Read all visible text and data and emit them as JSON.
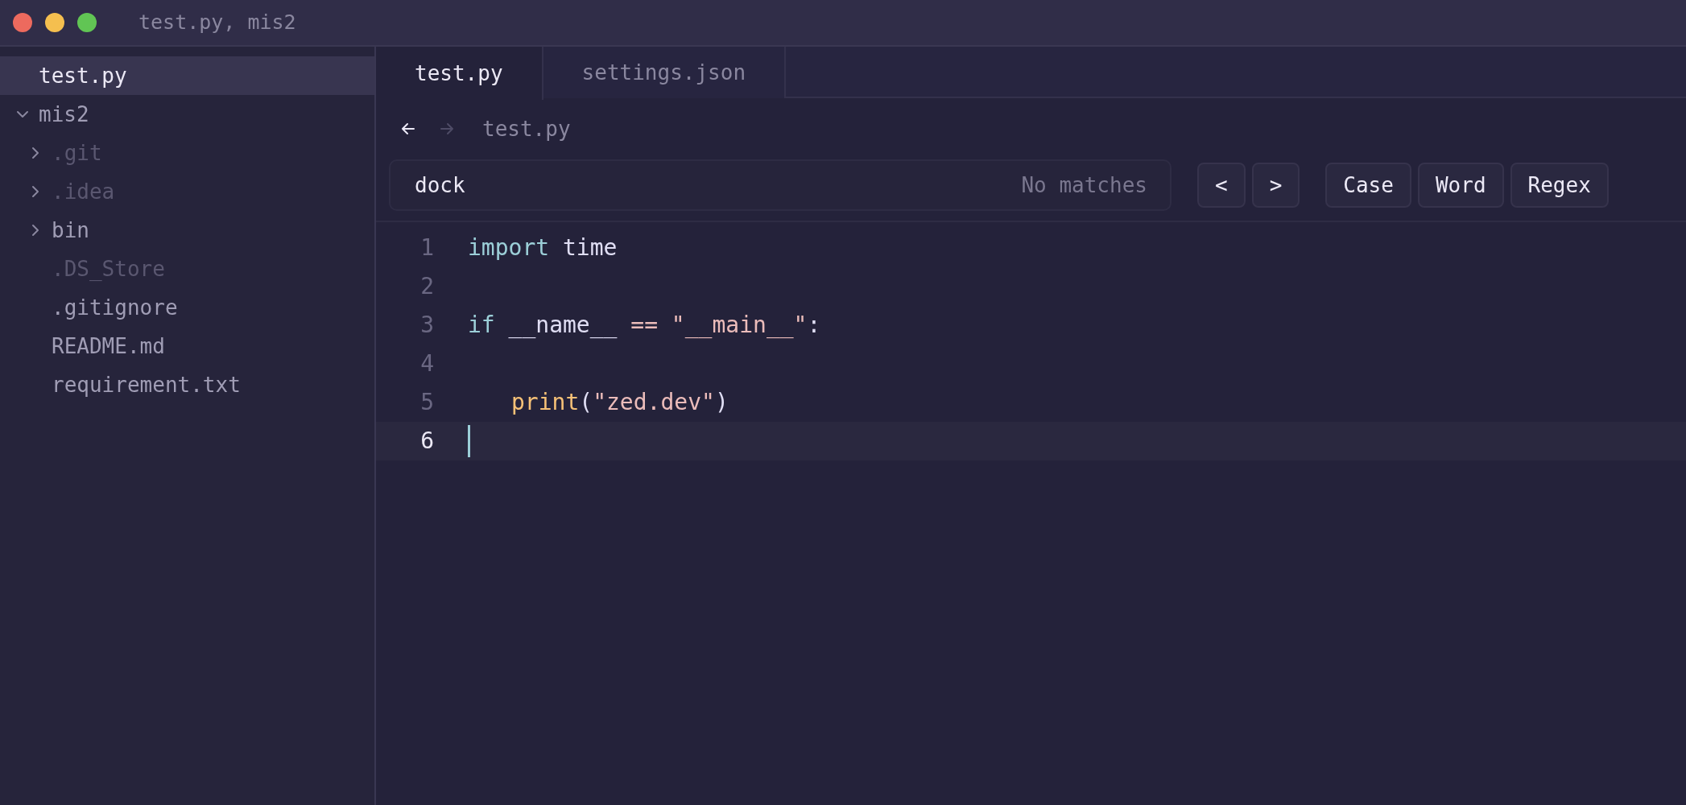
{
  "window": {
    "title": "test.py, mis2"
  },
  "tree": [
    {
      "label": "test.py",
      "kind": "file",
      "selected": true,
      "ignored": false
    },
    {
      "label": "mis2",
      "kind": "folder",
      "expanded": true,
      "selected": false,
      "ignored": false,
      "children": [
        {
          "label": ".git",
          "kind": "folder",
          "expanded": false,
          "selected": false,
          "ignored": true
        },
        {
          "label": ".idea",
          "kind": "folder",
          "expanded": false,
          "selected": false,
          "ignored": true
        },
        {
          "label": "bin",
          "kind": "folder",
          "expanded": false,
          "selected": false,
          "ignored": false
        },
        {
          "label": ".DS_Store",
          "kind": "file",
          "selected": false,
          "ignored": true
        },
        {
          "label": ".gitignore",
          "kind": "file",
          "selected": false,
          "ignored": false
        },
        {
          "label": "README.md",
          "kind": "file",
          "selected": false,
          "ignored": false
        },
        {
          "label": "requirement.txt",
          "kind": "file",
          "selected": false,
          "ignored": false
        }
      ]
    }
  ],
  "tabs": [
    {
      "label": "test.py",
      "selected": true
    },
    {
      "label": "settings.json",
      "selected": false
    }
  ],
  "breadcrumb": {
    "back_disabled": false,
    "forward_disabled": true,
    "path": "test.py"
  },
  "search": {
    "value": "dock",
    "status": "No matches",
    "nav_buttons": [
      "<",
      ">"
    ],
    "options": [
      {
        "label": "Case",
        "selected": false
      },
      {
        "label": "Word",
        "selected": false
      },
      {
        "label": "Regex",
        "selected": false
      }
    ]
  },
  "editor": {
    "lines": [
      {
        "number": "1",
        "current": false,
        "tokens": [
          {
            "kind": "keyword",
            "text": "import"
          },
          {
            "kind": "plain",
            "text": " time"
          }
        ]
      },
      {
        "number": "2",
        "current": false
      },
      {
        "number": "3",
        "current": false,
        "tokens": [
          {
            "kind": "keyword",
            "text": "if"
          },
          {
            "kind": "plain",
            "text": " __name__ "
          },
          {
            "kind": "operator",
            "text": "=="
          },
          {
            "kind": "string",
            "text": " \"__main__\""
          },
          {
            "kind": "plain",
            "text": ":"
          }
        ]
      },
      {
        "number": "4",
        "current": false
      },
      {
        "number": "5",
        "current": false,
        "indented": true,
        "tokens": [
          {
            "kind": "function",
            "text": "print"
          },
          {
            "kind": "plain",
            "text": "("
          },
          {
            "kind": "string",
            "text": "\"zed.dev\""
          },
          {
            "kind": "plain",
            "text": ")"
          }
        ]
      },
      {
        "number": "6",
        "current": true
      }
    ]
  }
}
